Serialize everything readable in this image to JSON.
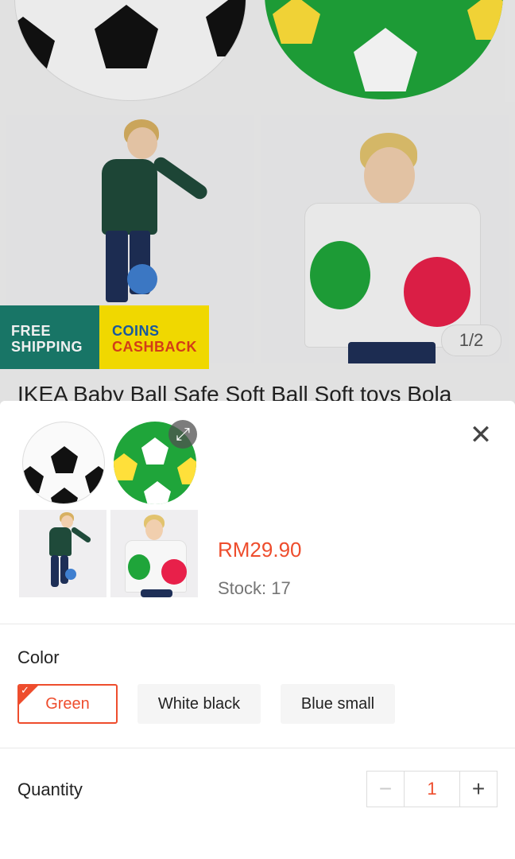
{
  "background": {
    "badge_free_shipping": "FREE SHIPPING",
    "badge_coins": "COINS",
    "badge_cashback": "CASHBACK",
    "pager": "1/2",
    "product_title": "IKEA Baby Ball Safe Soft Ball Soft toys Bola"
  },
  "sheet": {
    "price": "RM29.90",
    "stock": "Stock: 17",
    "color_label": "Color",
    "options": [
      "Green",
      "White black",
      "Blue small"
    ],
    "selected_option": "Green",
    "quantity_label": "Quantity",
    "quantity_value": "1",
    "minus_symbol": "−",
    "plus_symbol": "+",
    "close_symbol": "✕",
    "expand_symbol": "⤢",
    "check_symbol": "✓"
  },
  "colors": {
    "accent": "#ee4d2d",
    "ball_green": "#1fa53a",
    "badge_teal": "#1a7d6d",
    "badge_yellow": "#ffe600"
  },
  "icons": [
    "expand-icon",
    "close-icon",
    "check-icon",
    "minus-icon",
    "plus-icon"
  ]
}
